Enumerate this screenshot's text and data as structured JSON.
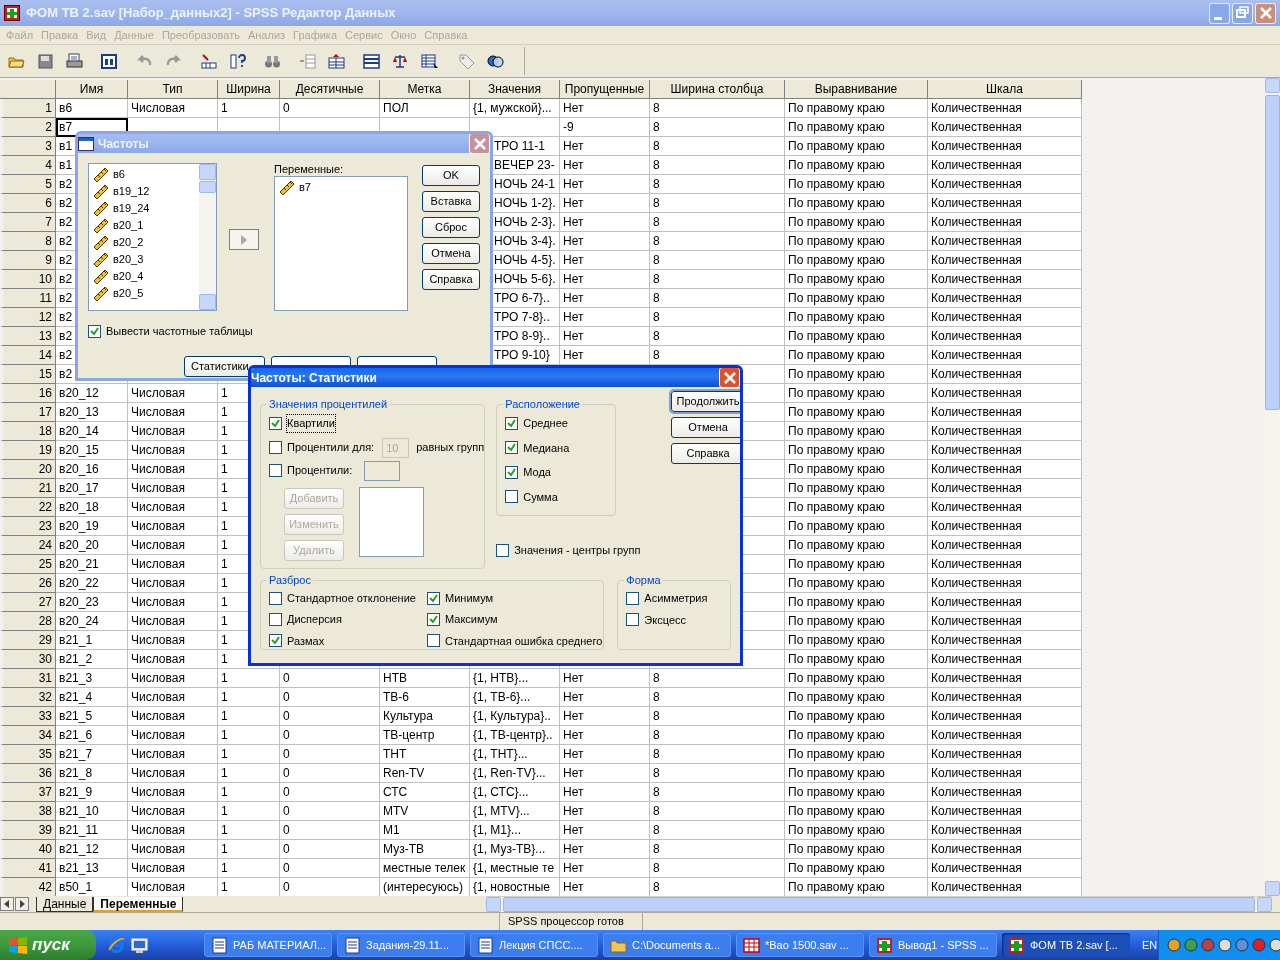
{
  "window": {
    "title": "ФОМ ТВ 2.sav [Набор_данных2] - SPSS Редактор Данных",
    "active": false
  },
  "menu": [
    {
      "label": "Файл",
      "disabled": true
    },
    {
      "label": "Правка",
      "disabled": true
    },
    {
      "label": "Вид",
      "disabled": true
    },
    {
      "label": "Данные",
      "disabled": true
    },
    {
      "label": "Преобразовать",
      "disabled": true
    },
    {
      "label": "Анализ",
      "disabled": true
    },
    {
      "label": "Графика",
      "disabled": true
    },
    {
      "label": "Сервис",
      "disabled": true
    },
    {
      "label": "Окно",
      "disabled": true
    },
    {
      "label": "Справка",
      "disabled": true
    }
  ],
  "grid": {
    "columns": [
      "Имя",
      "Тип",
      "Ширина",
      "Десятичные",
      "Метка",
      "Значения",
      "Пропущенные",
      "Ширина столбца",
      "Выравнивание",
      "Шкала"
    ],
    "rows": [
      {
        "active": false,
        "number": "1",
        "cells": [
          "в6",
          "Числовая",
          "1",
          "0",
          "ПОЛ",
          "{1, мужской}...",
          "Нет",
          "8",
          "По правому краю",
          "Количественная"
        ]
      },
      {
        "active": true,
        "number": "2",
        "cells": [
          "в7",
          null,
          null,
          null,
          null,
          null,
          "-9",
          "8",
          "По правому краю",
          "Количественная"
        ]
      },
      {
        "active": false,
        "number": "3",
        "cells": [
          "в1",
          null,
          null,
          null,
          null,
          "ТРО 11-1",
          "Нет",
          "8",
          "По правому краю",
          "Количественная"
        ]
      },
      {
        "active": false,
        "number": "4",
        "cells": [
          "в1",
          null,
          null,
          null,
          null,
          "ВЕЧЕР 23-",
          "Нет",
          "8",
          "По правому краю",
          "Количественная"
        ]
      },
      {
        "active": false,
        "number": "5",
        "cells": [
          "в2",
          null,
          null,
          null,
          null,
          "НОЧЬ 24-1",
          "Нет",
          "8",
          "По правому краю",
          "Количественная"
        ]
      },
      {
        "active": false,
        "number": "6",
        "cells": [
          "в2",
          null,
          null,
          null,
          null,
          "НОЧЬ 1-2}.",
          "Нет",
          "8",
          "По правому краю",
          "Количественная"
        ]
      },
      {
        "active": false,
        "number": "7",
        "cells": [
          "в2",
          null,
          null,
          null,
          null,
          "НОЧЬ 2-3}.",
          "Нет",
          "8",
          "По правому краю",
          "Количественная"
        ]
      },
      {
        "active": false,
        "number": "8",
        "cells": [
          "в2",
          null,
          null,
          null,
          null,
          "НОЧЬ 3-4}.",
          "Нет",
          "8",
          "По правому краю",
          "Количественная"
        ]
      },
      {
        "active": false,
        "number": "9",
        "cells": [
          "в2",
          null,
          null,
          null,
          null,
          "НОЧЬ 4-5}.",
          "Нет",
          "8",
          "По правому краю",
          "Количественная"
        ]
      },
      {
        "active": false,
        "number": "10",
        "cells": [
          "в2",
          null,
          null,
          null,
          null,
          "НОЧЬ 5-6}.",
          "Нет",
          "8",
          "По правому краю",
          "Количественная"
        ]
      },
      {
        "active": false,
        "number": "11",
        "cells": [
          "в2",
          null,
          null,
          null,
          null,
          "ТРО 6-7}..",
          "Нет",
          "8",
          "По правому краю",
          "Количественная"
        ]
      },
      {
        "active": false,
        "number": "12",
        "cells": [
          "в2",
          null,
          null,
          null,
          null,
          "ТРО 7-8}..",
          "Нет",
          "8",
          "По правому краю",
          "Количественная"
        ]
      },
      {
        "active": false,
        "number": "13",
        "cells": [
          "в2",
          null,
          null,
          null,
          null,
          "ТРО 8-9}..",
          "Нет",
          "8",
          "По правому краю",
          "Количественная"
        ]
      },
      {
        "active": false,
        "number": "14",
        "cells": [
          "в2",
          null,
          null,
          null,
          null,
          "ТРО 9-10}",
          "Нет",
          "8",
          "По правому краю",
          "Количественная"
        ]
      },
      {
        "active": false,
        "number": "15",
        "cells": [
          "в2",
          null,
          null,
          null,
          null,
          null,
          null,
          null,
          "По правому краю",
          "Количественная"
        ]
      },
      {
        "active": false,
        "number": "16",
        "cells": [
          "в20_12",
          "Числовая",
          "1",
          null,
          null,
          null,
          null,
          null,
          "По правому краю",
          "Количественная"
        ]
      },
      {
        "active": false,
        "number": "17",
        "cells": [
          "в20_13",
          "Числовая",
          "1",
          null,
          null,
          null,
          null,
          null,
          "По правому краю",
          "Количественная"
        ]
      },
      {
        "active": false,
        "number": "18",
        "cells": [
          "в20_14",
          "Числовая",
          "1",
          null,
          null,
          null,
          null,
          null,
          "По правому краю",
          "Количественная"
        ]
      },
      {
        "active": false,
        "number": "19",
        "cells": [
          "в20_15",
          "Числовая",
          "1",
          null,
          null,
          null,
          null,
          null,
          "По правому краю",
          "Количественная"
        ]
      },
      {
        "active": false,
        "number": "20",
        "cells": [
          "в20_16",
          "Числовая",
          "1",
          null,
          null,
          null,
          null,
          null,
          "По правому краю",
          "Количественная"
        ]
      },
      {
        "active": false,
        "number": "21",
        "cells": [
          "в20_17",
          "Числовая",
          "1",
          null,
          null,
          null,
          null,
          null,
          "По правому краю",
          "Количественная"
        ]
      },
      {
        "active": false,
        "number": "22",
        "cells": [
          "в20_18",
          "Числовая",
          "1",
          null,
          null,
          null,
          null,
          null,
          "По правому краю",
          "Количественная"
        ]
      },
      {
        "active": false,
        "number": "23",
        "cells": [
          "в20_19",
          "Числовая",
          "1",
          null,
          null,
          null,
          null,
          null,
          "По правому краю",
          "Количественная"
        ]
      },
      {
        "active": false,
        "number": "24",
        "cells": [
          "в20_20",
          "Числовая",
          "1",
          null,
          null,
          null,
          null,
          null,
          "По правому краю",
          "Количественная"
        ]
      },
      {
        "active": false,
        "number": "25",
        "cells": [
          "в20_21",
          "Числовая",
          "1",
          null,
          null,
          null,
          null,
          null,
          "По правому краю",
          "Количественная"
        ]
      },
      {
        "active": false,
        "number": "26",
        "cells": [
          "в20_22",
          "Числовая",
          "1",
          null,
          null,
          null,
          null,
          null,
          "По правому краю",
          "Количественная"
        ]
      },
      {
        "active": false,
        "number": "27",
        "cells": [
          "в20_23",
          "Числовая",
          "1",
          null,
          null,
          null,
          null,
          null,
          "По правому краю",
          "Количественная"
        ]
      },
      {
        "active": false,
        "number": "28",
        "cells": [
          "в20_24",
          "Числовая",
          "1",
          null,
          null,
          null,
          null,
          null,
          "По правому краю",
          "Количественная"
        ]
      },
      {
        "active": false,
        "number": "29",
        "cells": [
          "в21_1",
          "Числовая",
          "1",
          null,
          null,
          null,
          null,
          null,
          "По правому краю",
          "Количественная"
        ]
      },
      {
        "active": false,
        "number": "30",
        "cells": [
          "в21_2",
          "Числовая",
          "1",
          null,
          null,
          null,
          null,
          null,
          "По правому краю",
          "Количественная"
        ]
      },
      {
        "active": false,
        "number": "31",
        "cells": [
          "в21_3",
          "Числовая",
          "1",
          "0",
          "НТВ",
          "{1, НТВ}...",
          "Нет",
          "8",
          "По правому краю",
          "Количественная"
        ]
      },
      {
        "active": false,
        "number": "32",
        "cells": [
          "в21_4",
          "Числовая",
          "1",
          "0",
          "ТВ-6",
          "{1, ТВ-6}...",
          "Нет",
          "8",
          "По правому краю",
          "Количественная"
        ]
      },
      {
        "active": false,
        "number": "33",
        "cells": [
          "в21_5",
          "Числовая",
          "1",
          "0",
          "Культура",
          "{1, Культура}..",
          "Нет",
          "8",
          "По правому краю",
          "Количественная"
        ]
      },
      {
        "active": false,
        "number": "34",
        "cells": [
          "в21_6",
          "Числовая",
          "1",
          "0",
          "ТВ-центр",
          "{1, ТВ-центр}..",
          "Нет",
          "8",
          "По правому краю",
          "Количественная"
        ]
      },
      {
        "active": false,
        "number": "35",
        "cells": [
          "в21_7",
          "Числовая",
          "1",
          "0",
          "ТНТ",
          "{1, ТНТ}...",
          "Нет",
          "8",
          "По правому краю",
          "Количественная"
        ]
      },
      {
        "active": false,
        "number": "36",
        "cells": [
          "в21_8",
          "Числовая",
          "1",
          "0",
          "Ren-TV",
          "{1, Ren-TV}...",
          "Нет",
          "8",
          "По правому краю",
          "Количественная"
        ]
      },
      {
        "active": false,
        "number": "37",
        "cells": [
          "в21_9",
          "Числовая",
          "1",
          "0",
          "СТС",
          "{1, СТС}...",
          "Нет",
          "8",
          "По правому краю",
          "Количественная"
        ]
      },
      {
        "active": false,
        "number": "38",
        "cells": [
          "в21_10",
          "Числовая",
          "1",
          "0",
          "MTV",
          "{1, MTV}...",
          "Нет",
          "8",
          "По правому краю",
          "Количественная"
        ]
      },
      {
        "active": false,
        "number": "39",
        "cells": [
          "в21_11",
          "Числовая",
          "1",
          "0",
          "М1",
          "{1, М1}...",
          "Нет",
          "8",
          "По правому краю",
          "Количественная"
        ]
      },
      {
        "active": false,
        "number": "40",
        "cells": [
          "в21_12",
          "Числовая",
          "1",
          "0",
          "Муз-ТВ",
          "{1, Муз-ТВ}...",
          "Нет",
          "8",
          "По правому краю",
          "Количественная"
        ]
      },
      {
        "active": false,
        "number": "41",
        "cells": [
          "в21_13",
          "Числовая",
          "1",
          "0",
          "местные телек",
          "{1, местные те",
          "Нет",
          "8",
          "По правому краю",
          "Количественная"
        ]
      },
      {
        "active": false,
        "number": "42",
        "cells": [
          "в50_1",
          "Числовая",
          "1",
          "0",
          "(интересуюсь)",
          "{1, новостные",
          "Нет",
          "8",
          "По правому краю",
          "Количественная"
        ]
      }
    ]
  },
  "sheet_tabs": [
    {
      "label": "Данные",
      "selected": false
    },
    {
      "label": "Переменные",
      "selected": true
    }
  ],
  "status_bar": "SPSS процессор готов",
  "frequencies_dialog": {
    "title": "Частоты",
    "active": false,
    "source_list": [
      "в6",
      "в19_12",
      "в19_24",
      "в20_1",
      "в20_2",
      "в20_3",
      "в20_4",
      "в20_5"
    ],
    "target_label": "Переменные:",
    "target_list": [
      "в7"
    ],
    "buttons": [
      "OK",
      "Вставка",
      "Сброс",
      "Отмена",
      "Справка"
    ],
    "display_tables": {
      "label": "Вывести частотные таблицы",
      "checked": true
    },
    "statistics_button": "Статистики"
  },
  "statistics_dialog": {
    "title": "Частоты: Статистики",
    "active": true,
    "percentile_group": {
      "title": "Значения процентилей",
      "quartiles": {
        "label": "Квартили",
        "checked": true,
        "focused": true
      },
      "cut_points": {
        "label": "Процентили для:",
        "checked": false,
        "value": "10",
        "suffix": "равных групп"
      },
      "percentiles": {
        "label": "Процентили:",
        "checked": false
      },
      "buttons": [
        {
          "label": "Добавить",
          "disabled": true
        },
        {
          "label": "Изменить",
          "disabled": true
        },
        {
          "label": "Удалить",
          "disabled": true
        }
      ]
    },
    "central_group": {
      "title": "Расположение",
      "items": [
        {
          "label": "Среднее",
          "checked": true
        },
        {
          "label": "Медиана",
          "checked": true
        },
        {
          "label": "Мода",
          "checked": true
        },
        {
          "label": "Сумма",
          "checked": false
        }
      ]
    },
    "buttons": [
      {
        "label": "Продолжить",
        "default": true
      },
      {
        "label": "Отмена",
        "default": false
      },
      {
        "label": "Справка",
        "default": false
      }
    ],
    "midpoints": {
      "label": "Значения - центры групп",
      "checked": false
    },
    "dispersion_group": {
      "title": "Разброс",
      "items": [
        {
          "label": "Стандартное отклонение",
          "checked": false
        },
        {
          "label": "Дисперсия",
          "checked": false
        },
        {
          "label": "Размах",
          "checked": true
        },
        {
          "label": "Минимум",
          "checked": true
        },
        {
          "label": "Максимум",
          "checked": true
        },
        {
          "label": "Стандартная ошибка среднего",
          "checked": false
        }
      ]
    },
    "distribution_group": {
      "title": "Форма",
      "items": [
        {
          "label": "Асимметрия",
          "checked": false
        },
        {
          "label": "Эксцесс",
          "checked": false
        }
      ]
    }
  },
  "taskbar": {
    "start": "пуск",
    "tasks": [
      {
        "label": "РАБ МАТЕРИАЛ...",
        "kind": "document",
        "selected": false
      },
      {
        "label": "Задания-29.11...",
        "kind": "document",
        "selected": false
      },
      {
        "label": "Лекция СПСС....",
        "kind": "document",
        "selected": false
      },
      {
        "label": "C:\\Documents a...",
        "kind": "folder",
        "selected": false
      },
      {
        "label": "*Вао 1500.sav ...",
        "kind": "grid",
        "selected": false
      },
      {
        "label": "Вывод1 - SPSS ...",
        "kind": "spss",
        "selected": false
      },
      {
        "label": "ФОМ ТВ 2.sav [...",
        "kind": "spss",
        "selected": true
      }
    ],
    "language": "EN"
  }
}
